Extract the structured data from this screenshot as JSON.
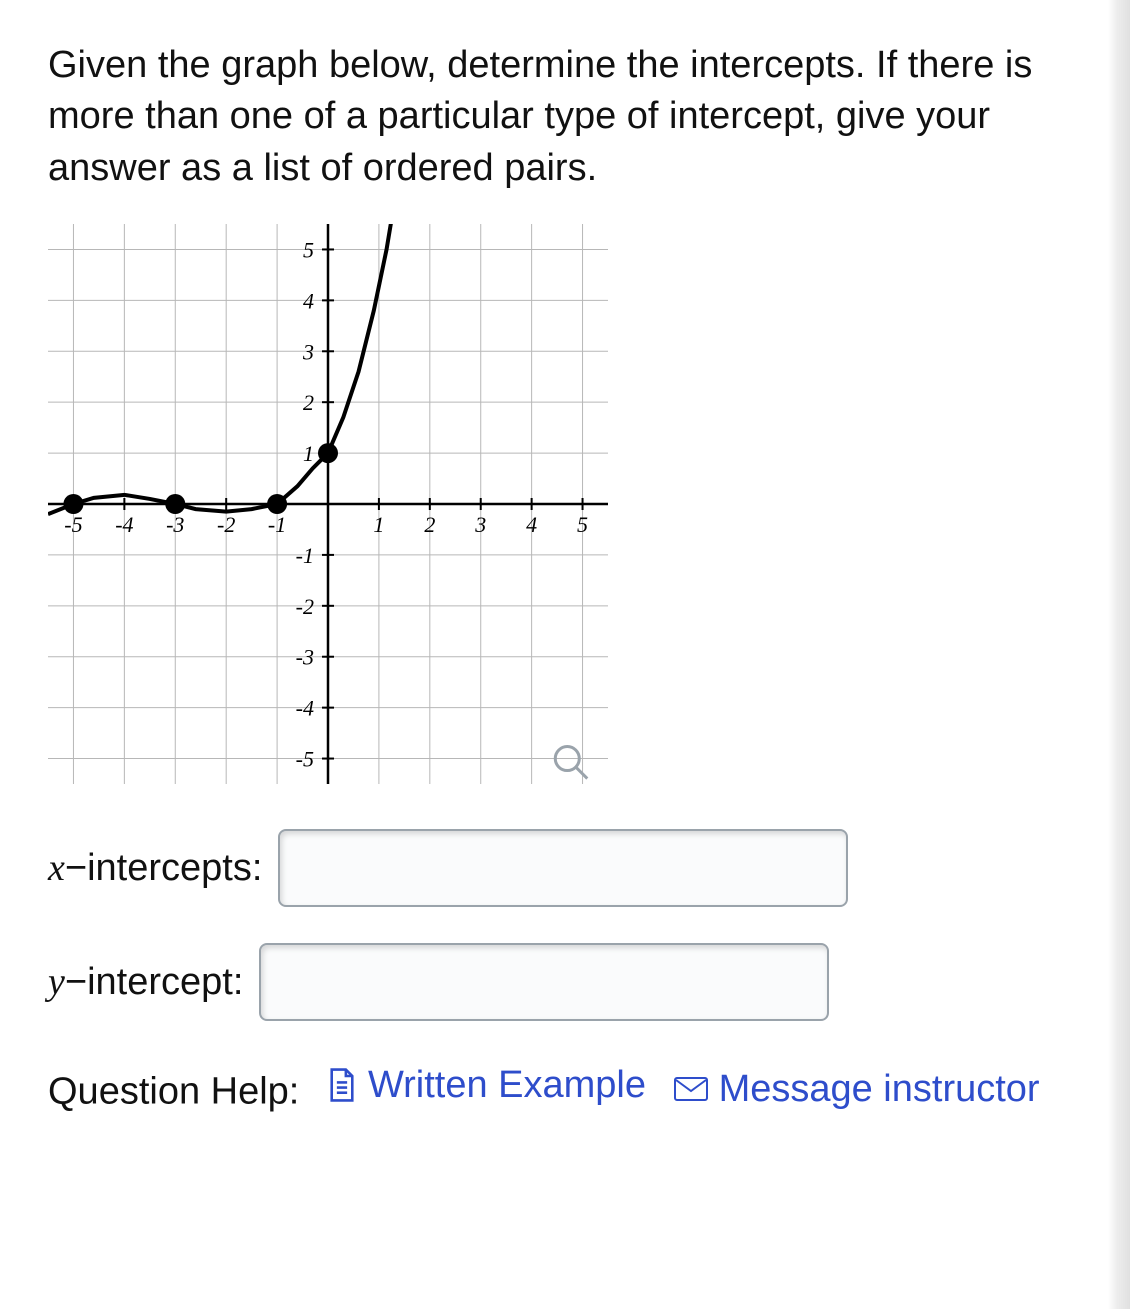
{
  "question": "Given the graph below, determine the intercepts. If there is more than one of a particular type of intercept, give your answer as a list of ordered pairs.",
  "labels": {
    "x_intercepts_var": "x",
    "x_intercepts_suffix": "−intercepts:",
    "y_intercept_var": "y",
    "y_intercept_suffix": "−intercept:"
  },
  "inputs": {
    "x_intercepts_value": "",
    "y_intercept_value": ""
  },
  "help": {
    "label": "Question Help:",
    "written_example": "Written Example",
    "message": "Message instructor"
  },
  "chart_data": {
    "type": "line",
    "xlabel": "",
    "ylabel": "",
    "xlim": [
      -5.5,
      5.5
    ],
    "ylim": [
      -5.5,
      5.5
    ],
    "x_ticks": [
      -5,
      -4,
      -3,
      -2,
      -1,
      1,
      2,
      3,
      4,
      5
    ],
    "y_ticks": [
      -5,
      -4,
      -3,
      -2,
      -1,
      1,
      2,
      3,
      4,
      5
    ],
    "grid": true,
    "points_marked": [
      [
        -5,
        0
      ],
      [
        -3,
        0
      ],
      [
        -1,
        0
      ],
      [
        0,
        1
      ]
    ],
    "curve": [
      [
        -5.5,
        -0.2
      ],
      [
        -5,
        0
      ],
      [
        -4.6,
        0.12
      ],
      [
        -4,
        0.18
      ],
      [
        -3.5,
        0.1
      ],
      [
        -3,
        0
      ],
      [
        -2.6,
        -0.1
      ],
      [
        -2,
        -0.15
      ],
      [
        -1.5,
        -0.1
      ],
      [
        -1,
        0
      ],
      [
        -0.6,
        0.35
      ],
      [
        -0.3,
        0.7
      ],
      [
        0,
        1
      ],
      [
        0.3,
        1.7
      ],
      [
        0.6,
        2.6
      ],
      [
        0.9,
        3.8
      ],
      [
        1.15,
        5
      ],
      [
        1.35,
        6.2
      ]
    ],
    "magnifier_icon_at": [
      4.7,
      -5
    ]
  }
}
